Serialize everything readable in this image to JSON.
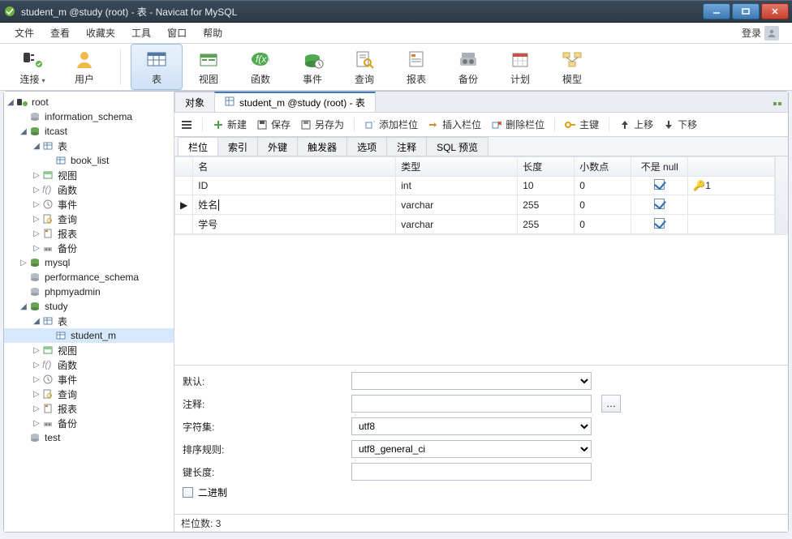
{
  "window": {
    "title": "student_m @study (root) - 表 - Navicat for MySQL"
  },
  "menu": {
    "items": [
      "文件",
      "查看",
      "收藏夹",
      "工具",
      "窗口",
      "帮助"
    ],
    "login": "登录"
  },
  "toolbar": {
    "items": [
      {
        "label": "连接",
        "icon": "plug",
        "dropdown": true
      },
      {
        "label": "用户",
        "icon": "user"
      }
    ],
    "main": [
      {
        "label": "表",
        "icon": "table",
        "active": true
      },
      {
        "label": "视图",
        "icon": "view"
      },
      {
        "label": "函数",
        "icon": "fx"
      },
      {
        "label": "事件",
        "icon": "event"
      },
      {
        "label": "查询",
        "icon": "query"
      },
      {
        "label": "报表",
        "icon": "report"
      },
      {
        "label": "备份",
        "icon": "backup"
      },
      {
        "label": "计划",
        "icon": "schedule"
      },
      {
        "label": "模型",
        "icon": "model"
      }
    ]
  },
  "tree": [
    {
      "d": 1,
      "exp": "open",
      "icon": "conn-green",
      "label": "root"
    },
    {
      "d": 2,
      "exp": "none",
      "icon": "db-grey",
      "label": "information_schema"
    },
    {
      "d": 2,
      "exp": "open",
      "icon": "db-green",
      "label": "itcast"
    },
    {
      "d": 3,
      "exp": "open",
      "icon": "tbl",
      "label": "表"
    },
    {
      "d": 4,
      "exp": "none",
      "icon": "tbl",
      "label": "book_list"
    },
    {
      "d": 3,
      "exp": "closed",
      "icon": "view",
      "label": "视图"
    },
    {
      "d": 3,
      "exp": "closed",
      "icon": "fx",
      "label": "函数"
    },
    {
      "d": 3,
      "exp": "closed",
      "icon": "event",
      "label": "事件"
    },
    {
      "d": 3,
      "exp": "closed",
      "icon": "query",
      "label": "查询"
    },
    {
      "d": 3,
      "exp": "closed",
      "icon": "report",
      "label": "报表"
    },
    {
      "d": 3,
      "exp": "closed",
      "icon": "backup",
      "label": "备份"
    },
    {
      "d": 2,
      "exp": "closed",
      "icon": "db-green",
      "label": "mysql"
    },
    {
      "d": 2,
      "exp": "none",
      "icon": "db-grey",
      "label": "performance_schema"
    },
    {
      "d": 2,
      "exp": "none",
      "icon": "db-grey",
      "label": "phpmyadmin"
    },
    {
      "d": 2,
      "exp": "open",
      "icon": "db-green",
      "label": "study"
    },
    {
      "d": 3,
      "exp": "open",
      "icon": "tbl",
      "label": "表"
    },
    {
      "d": 4,
      "exp": "none",
      "icon": "tbl",
      "label": "student_m",
      "selected": true
    },
    {
      "d": 3,
      "exp": "closed",
      "icon": "view",
      "label": "视图"
    },
    {
      "d": 3,
      "exp": "closed",
      "icon": "fx",
      "label": "函数"
    },
    {
      "d": 3,
      "exp": "closed",
      "icon": "event",
      "label": "事件"
    },
    {
      "d": 3,
      "exp": "closed",
      "icon": "query",
      "label": "查询"
    },
    {
      "d": 3,
      "exp": "closed",
      "icon": "report",
      "label": "报表"
    },
    {
      "d": 3,
      "exp": "closed",
      "icon": "backup",
      "label": "备份"
    },
    {
      "d": 2,
      "exp": "none",
      "icon": "db-grey",
      "label": "test"
    }
  ],
  "tabs": {
    "items": [
      "对象",
      "student_m @study (root) - 表"
    ],
    "active": 1
  },
  "actions": {
    "new": "新建",
    "save": "保存",
    "saveas": "另存为",
    "addcol": "添加栏位",
    "inscol": "插入栏位",
    "delcol": "删除栏位",
    "pk": "主键",
    "up": "上移",
    "down": "下移"
  },
  "subtabs": {
    "items": [
      "栏位",
      "索引",
      "外键",
      "触发器",
      "选项",
      "注释",
      "SQL 预览"
    ],
    "active": 0
  },
  "columns_grid": {
    "headers": {
      "name": "名",
      "type": "类型",
      "length": "长度",
      "decimals": "小数点",
      "notnull": "不是 null",
      "blank": ""
    },
    "rows": [
      {
        "marker": "",
        "name": "ID",
        "type": "int",
        "length": "10",
        "decimals": "0",
        "notnull": true,
        "key": "1"
      },
      {
        "marker": "▶",
        "name": "姓名",
        "type": "varchar",
        "length": "255",
        "decimals": "0",
        "notnull": true,
        "key": "",
        "editing": true
      },
      {
        "marker": "",
        "name": "学号",
        "type": "varchar",
        "length": "255",
        "decimals": "0",
        "notnull": true,
        "key": ""
      }
    ]
  },
  "properties": {
    "default_lbl": "默认:",
    "default_val": "",
    "comment_lbl": "注释:",
    "comment_val": "",
    "charset_lbl": "字符集:",
    "charset_val": "utf8",
    "collation_lbl": "排序规则:",
    "collation_val": "utf8_general_ci",
    "keylen_lbl": "键长度:",
    "keylen_val": "",
    "binary_lbl": "二进制",
    "binary_checked": false
  },
  "status": {
    "text": "栏位数: 3"
  }
}
